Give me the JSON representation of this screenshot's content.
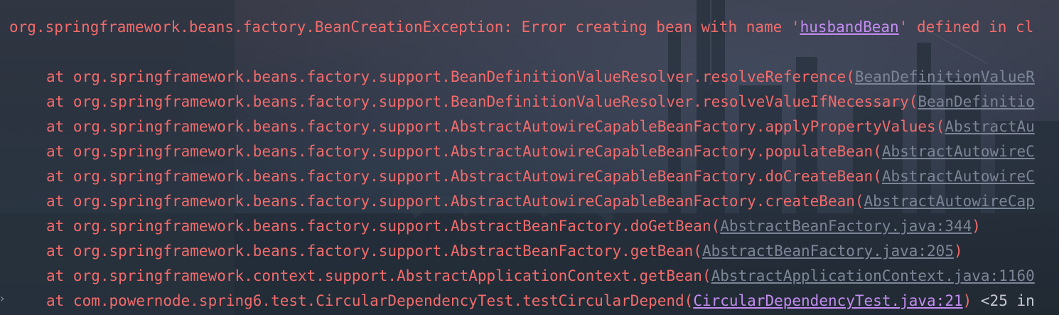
{
  "colors": {
    "error_text": "#f26b6b",
    "link_primary": "#c38cf2",
    "link_secondary": "#7c8596",
    "hint_text": "#c7c7d2"
  },
  "header": {
    "prefix": "org.springframework.beans.factory.BeanCreationException: Error creating bean with name '",
    "bean_name": "husbandBean",
    "suffix": "' defined in cl"
  },
  "stack_frames": [
    {
      "text": "at org.springframework.beans.factory.support.BeanDefinitionValueResolver.resolveReference(",
      "source": "BeanDefinitionValueR",
      "close": ""
    },
    {
      "text": "at org.springframework.beans.factory.support.BeanDefinitionValueResolver.resolveValueIfNecessary(",
      "source": "BeanDefinitio",
      "close": ""
    },
    {
      "text": "at org.springframework.beans.factory.support.AbstractAutowireCapableBeanFactory.applyPropertyValues(",
      "source": "AbstractAu",
      "close": ""
    },
    {
      "text": "at org.springframework.beans.factory.support.AbstractAutowireCapableBeanFactory.populateBean(",
      "source": "AbstractAutowireC",
      "close": ""
    },
    {
      "text": "at org.springframework.beans.factory.support.AbstractAutowireCapableBeanFactory.doCreateBean(",
      "source": "AbstractAutowireC",
      "close": ""
    },
    {
      "text": "at org.springframework.beans.factory.support.AbstractAutowireCapableBeanFactory.createBean(",
      "source": "AbstractAutowireCap",
      "close": ""
    },
    {
      "text": "at org.springframework.beans.factory.support.AbstractBeanFactory.doGetBean(",
      "source": "AbstractBeanFactory.java:344",
      "close": ")"
    },
    {
      "text": "at org.springframework.beans.factory.support.AbstractBeanFactory.getBean(",
      "source": "AbstractBeanFactory.java:205",
      "close": ")"
    },
    {
      "text": "at org.springframework.context.support.AbstractApplicationContext.getBean(",
      "source": "AbstractApplicationContext.java:1160",
      "close": ""
    },
    {
      "text": "at com.powernode.spring6.test.CircularDependencyTest.testCircularDepend(",
      "source": "CircularDependencyTest.java:21",
      "close": ")",
      "hint": " <25 in"
    }
  ]
}
